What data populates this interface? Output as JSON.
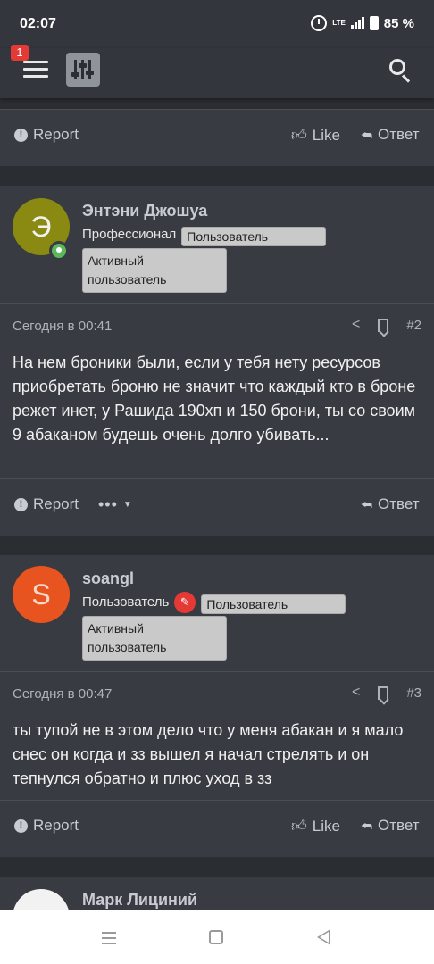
{
  "status_bar": {
    "time": "02:07",
    "network": "LTE",
    "battery": "85 %"
  },
  "header": {
    "notification_count": "1"
  },
  "first_footer": {
    "report_label": "Report",
    "like_label": "Like",
    "reply_label": "Ответ"
  },
  "posts": [
    {
      "author": "Энтэни Джошуа",
      "avatar_letter": "Э",
      "avatar_color": "#8a8a12",
      "user_title": "Профессионал",
      "banners": [
        "Пользователь",
        "Активный пользователь"
      ],
      "date": "Сегодня в 00:41",
      "number": "#2",
      "body": "На нем броники были, если у тебя нету ресурсов приобретать броню не значит что каждый кто в броне режет инет, у Рашида 190хп и 150 брони, ты со своим 9 абаканом будешь очень долго убивать...",
      "report_label": "Report",
      "reply_label": "Ответ"
    },
    {
      "author": "soangl",
      "avatar_letter": "S",
      "avatar_color": "#e8541f",
      "user_title": "Пользователь",
      "banners": [
        "Пользователь",
        "Активный пользователь"
      ],
      "date": "Сегодня в 00:47",
      "number": "#3",
      "body": "ты тупой не в этом дело что у меня абакан и я мало снес он когда и зз вышел я начал стрелять и он тепнулся обратно и плюс уход в зз",
      "report_label": "Report",
      "like_label": "Like",
      "reply_label": "Ответ"
    },
    {
      "author": "Марк Лициний"
    }
  ]
}
